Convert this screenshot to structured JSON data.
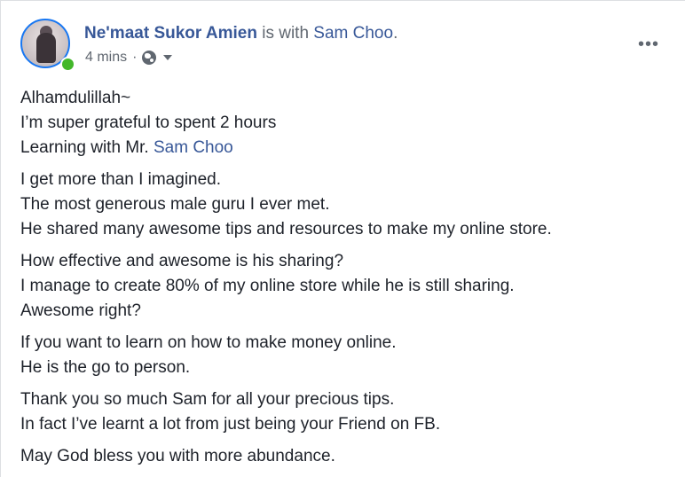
{
  "post": {
    "author": "Ne'maat Sukor Amien",
    "with_text": " is with ",
    "tagged": "Sam Choo",
    "tagged_suffix": ".",
    "time": "4 mins",
    "separator": "·",
    "privacy_icon": "globe-icon",
    "menu_icon": "more-options-icon",
    "menu_label": "•••"
  },
  "body": {
    "p1": {
      "l1": "Alhamdulillah~",
      "l2": "I’m super grateful to spent 2 hours",
      "l3_prefix": "Learning with Mr. ",
      "l3_link": "Sam Choo"
    },
    "p2": {
      "l1": "I get more than I imagined.",
      "l2": "The most generous male guru I ever met.",
      "l3": "He shared many awesome tips and resources to make my online store."
    },
    "p3": {
      "l1": "How effective and awesome is his sharing?",
      "l2": "I manage to create 80% of my online store while he is still sharing.",
      "l3": "Awesome right?"
    },
    "p4": {
      "l1": "If you want to learn on how to make money online.",
      "l2": "He is the go to person."
    },
    "p5": {
      "l1": "Thank you so much Sam for all your precious tips.",
      "l2": "In fact I’ve learnt a lot from just being your Friend on FB."
    },
    "p6": {
      "l1": "May God bless you with more abundance."
    }
  },
  "colors": {
    "link": "#385898",
    "meta": "#606770",
    "online": "#42b72a"
  }
}
